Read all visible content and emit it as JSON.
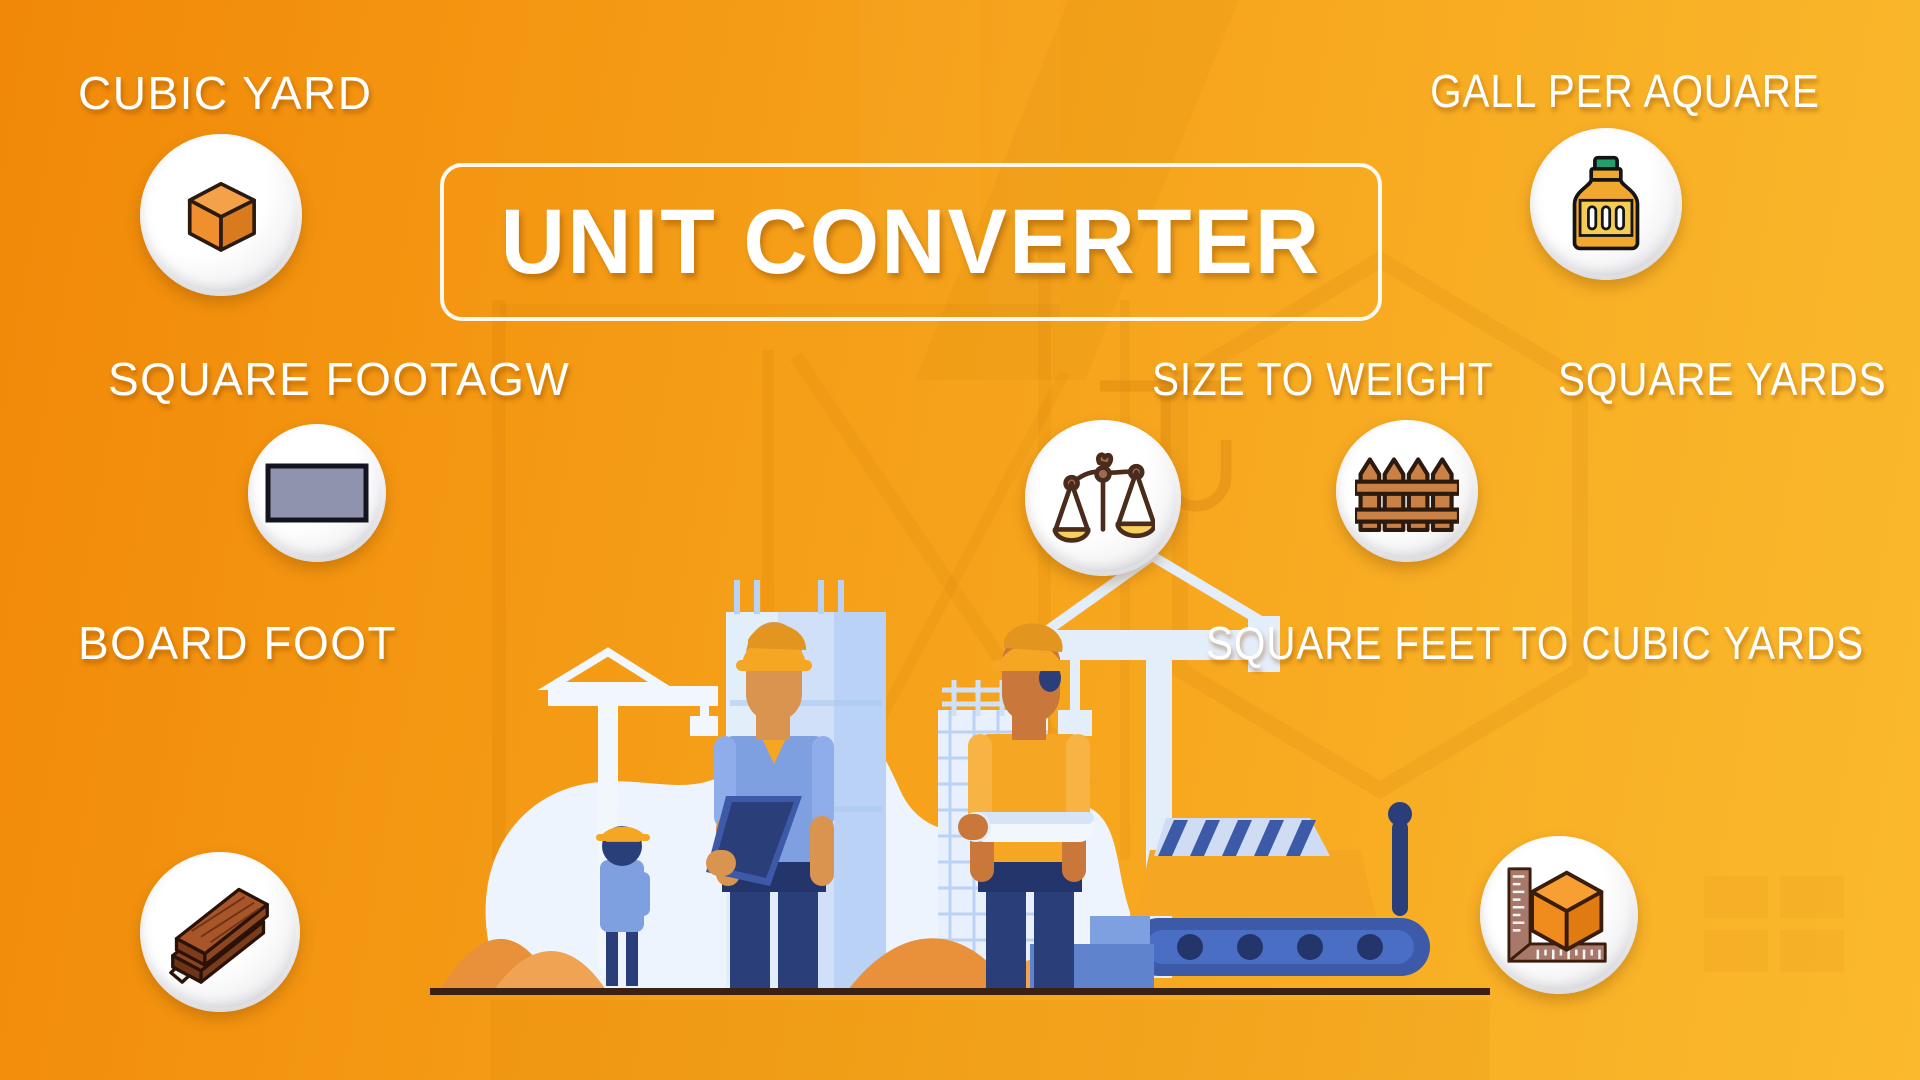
{
  "page": {
    "title": "UNIT CONVERTER",
    "background_gradient_from": "#f18808",
    "background_gradient_to": "#fbb92d",
    "badge_face_color": "#ffffff",
    "label_color": "#ffffff"
  },
  "items": [
    {
      "key": "cubic-yard",
      "label": "CUBIC YARD",
      "icon": "orange-cube-icon",
      "icon_colors": {
        "front": "#ef8f2e",
        "top": "#f5a14a",
        "side": "#d97a1f",
        "outline": "#2a1a10"
      }
    },
    {
      "key": "gall-per-aquare",
      "label": "GALL PER AQUARE",
      "icon": "jug-bottle-icon",
      "icon_colors": {
        "body": "#f5cd52",
        "shoulder": "#f0a92e",
        "cap": "#22a06b",
        "outline": "#141414"
      }
    },
    {
      "key": "square-footagw",
      "label": "SQUARE FOOTAGW",
      "icon": "gray-rectangle-icon",
      "icon_colors": {
        "fill": "#9093ad",
        "outline": "#14141e"
      }
    },
    {
      "key": "size-to-weight",
      "label": "SIZE TO WEIGHT",
      "icon": "balance-scale-icon",
      "icon_colors": {
        "beam": "#9b6a52",
        "pan": "#f7cf5e",
        "outline": "#4a2c1c"
      }
    },
    {
      "key": "square-yards",
      "label": "SQUARE YARDS",
      "icon": "picket-fence-icon",
      "icon_colors": {
        "fill": "#c98146",
        "outline": "#2d1a0e"
      }
    },
    {
      "key": "board-foot",
      "label": "BOARD FOOT",
      "icon": "lumber-planks-icon",
      "icon_colors": {
        "plank": "#9b4f23",
        "plank_light": "#b35f2c",
        "tape": "#f2f2f2",
        "outline": "#2b1208"
      }
    },
    {
      "key": "square-feet-to-cubic-yards",
      "label": "SQUARE FEET TO CUBIC YARDS",
      "icon": "cube-with-ruler-icon",
      "icon_colors": {
        "cube_front": "#f08b1d",
        "cube_top": "#f79f32",
        "cube_side": "#e07b12",
        "ruler": "#a8796a",
        "outline": "#3a1d0c"
      }
    }
  ],
  "illustration": {
    "name": "construction-site-illustration",
    "description": "Construction workers with cranes, building and bulldozer",
    "colors": {
      "helmet": "#f5a623",
      "shirt_blue": "#7fa0e0",
      "shirt_orange": "#f5a623",
      "pants": "#2a3f7a",
      "building": "#b9d2f5",
      "white": "#eef4fd",
      "sand": "#e8903a",
      "ground": "#3a2112"
    }
  }
}
